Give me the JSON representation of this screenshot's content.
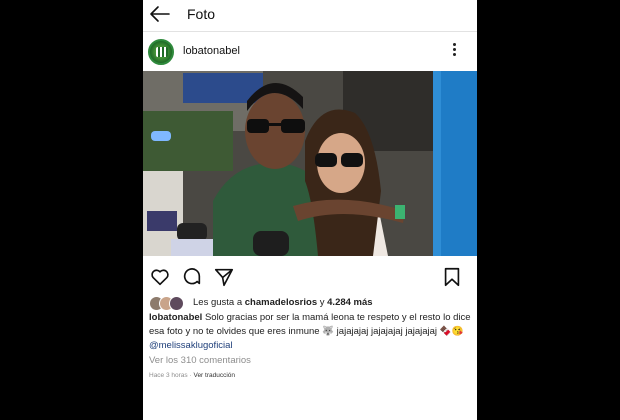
{
  "topbar": {
    "title": "Foto"
  },
  "post": {
    "username": "lobatonabel",
    "likes": {
      "prefix": "Les gusta a",
      "user": "chamadelosrios",
      "joiner": "y",
      "count": "4.284 más"
    },
    "caption": {
      "author": "lobatonabel",
      "text": "Solo gracias por ser la mamá leona te respeto y el resto lo dice esa foto y no te olvides que eres inmune 🐺 jajajajaj jajajajaj jajajajaj 🍫😘",
      "mention": "@melissaklugoficial"
    },
    "view_comments": "Ver los 310 comentarios",
    "time_ago": "Hace 3 horas",
    "separator": "·",
    "translate": "Ver traducción"
  },
  "colors": {
    "accent_link": "#1f3f7a",
    "muted": "#8e8e8e",
    "avatar_ring": "#2f8a3c"
  },
  "icons": [
    "back-arrow-icon",
    "more-options-icon",
    "heart-icon",
    "comment-icon",
    "share-icon",
    "bookmark-icon"
  ]
}
